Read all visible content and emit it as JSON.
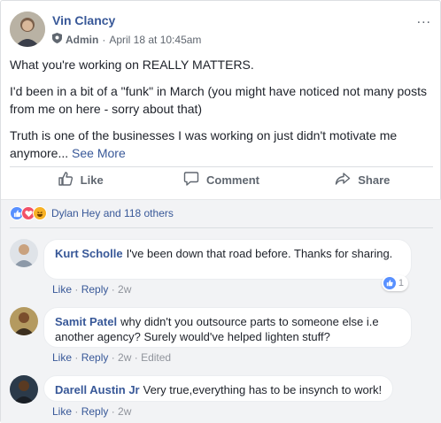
{
  "post": {
    "author": "Vin Clancy",
    "role": "Admin",
    "date": "April 18 at 10:45am",
    "paragraphs": [
      "What you're working on REALLY MATTERS.",
      "I'd been in a bit of a \"funk\" in March (you might have noticed not many posts from me on here - sorry about that)",
      "Truth is one of the businesses I was working on just didn't motivate me anymore..."
    ],
    "see_more": "See More",
    "more_menu": "..."
  },
  "actions": {
    "like": "Like",
    "comment": "Comment",
    "share": "Share"
  },
  "reactions": {
    "summary": "Dylan Hey and 118 others",
    "icons": [
      "like-icon",
      "love-icon",
      "haha-icon"
    ]
  },
  "comments": [
    {
      "name": "Kurt Scholle",
      "text": "I've been down that road before. Thanks for sharing.",
      "like": "Like",
      "reply": "Reply",
      "time": "2w",
      "reaction_count": "1"
    },
    {
      "name": "Samit Patel",
      "text": "why didn't you outsource parts to someone else i.e another agency? Surely would've helped lighten stuff?",
      "like": "Like",
      "reply": "Reply",
      "time": "2w",
      "edited": "Edited"
    },
    {
      "name": "Darell Austin Jr",
      "text": "Very true,everything has to be insynch to work!",
      "like": "Like",
      "reply": "Reply",
      "time": "2w"
    }
  ],
  "colors": {
    "link": "#385898",
    "muted": "#606770",
    "like_blue": "#5890ff",
    "love_red": "#f25268",
    "haha_yellow": "#f7b125"
  }
}
